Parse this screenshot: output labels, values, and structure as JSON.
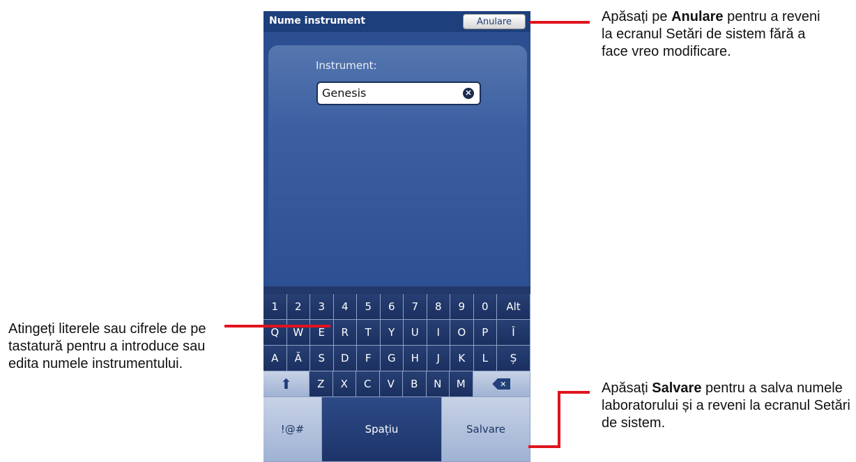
{
  "screen": {
    "title": "Nume instrument",
    "cancel_label": "Anulare",
    "field_label": "Instrument:",
    "field_value": "Genesis"
  },
  "keyboard": {
    "row1": [
      "1",
      "2",
      "3",
      "4",
      "5",
      "6",
      "7",
      "8",
      "9",
      "0",
      "Alt"
    ],
    "row2": [
      "Q",
      "W",
      "E",
      "R",
      "T",
      "Y",
      "U",
      "I",
      "O",
      "P",
      "Î"
    ],
    "row3": [
      "A",
      "Ă",
      "S",
      "D",
      "F",
      "G",
      "H",
      "J",
      "K",
      "L",
      "Ș"
    ],
    "row4": [
      "Z",
      "X",
      "C",
      "V",
      "B",
      "N",
      "M"
    ],
    "symbols_label": "!@#",
    "space_label": "Spațiu",
    "save_label": "Salvare"
  },
  "callouts": {
    "cancel": {
      "pre": "Apăsați pe ",
      "bold": "Anulare",
      "post": " pentru a reveni la ecranul Setări de sistem fără a face vreo modificare."
    },
    "keys": {
      "text": "Atingeți literele sau cifrele de pe tastatură pentru a introduce sau edita numele instrumentului."
    },
    "save": {
      "pre": "Apăsați ",
      "bold": "Salvare",
      "post": " pentru a salva numele laboratorului și a reveni la ecranul Setări de sistem."
    }
  },
  "colors": {
    "callout_line": "#e0141e",
    "screen_blue": "#2b4f90"
  }
}
